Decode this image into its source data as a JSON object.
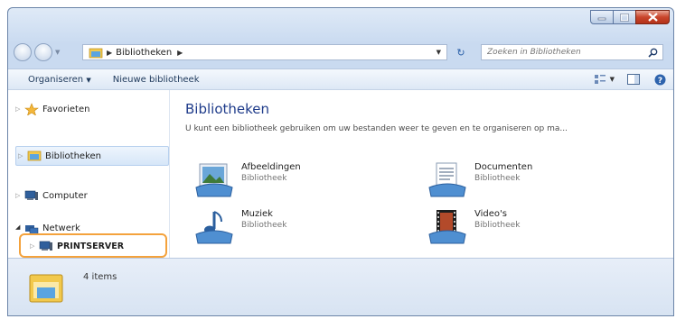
{
  "window": {
    "colors": {
      "accent": "#1e3b8a",
      "highlight": "#f4a23c",
      "close": "#c9452b"
    }
  },
  "address": {
    "crumbs": [
      "Bibliotheken"
    ],
    "search_placeholder": "Zoeken in Bibliotheken"
  },
  "toolbar": {
    "organize_label": "Organiseren",
    "new_library_label": "Nieuwe bibliotheek"
  },
  "nav": {
    "items": [
      {
        "label": "Favorieten",
        "icon": "star-icon"
      },
      {
        "label": "Bibliotheken",
        "icon": "libraries-icon"
      },
      {
        "label": "Computer",
        "icon": "computer-icon"
      },
      {
        "label": "Netwerk",
        "icon": "network-icon"
      },
      {
        "label": "PRINTSERVER",
        "icon": "server-icon"
      }
    ]
  },
  "content": {
    "title": "Bibliotheken",
    "description": "U kunt een bibliotheek gebruiken om uw bestanden weer te geven en te organiseren op ma...",
    "libraries": [
      {
        "name": "Afbeeldingen",
        "type": "Bibliotheek",
        "icon": "pictures-icon"
      },
      {
        "name": "Documenten",
        "type": "Bibliotheek",
        "icon": "documents-icon"
      },
      {
        "name": "Muziek",
        "type": "Bibliotheek",
        "icon": "music-icon"
      },
      {
        "name": "Video's",
        "type": "Bibliotheek",
        "icon": "videos-icon"
      }
    ]
  },
  "status": {
    "count": "4 items"
  }
}
